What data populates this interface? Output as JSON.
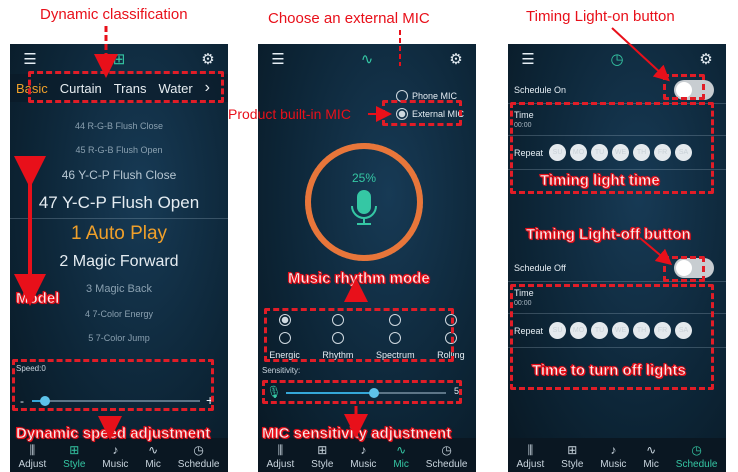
{
  "annotations": {
    "top_left": "Dynamic classification",
    "top_mid": "Choose an external MIC",
    "top_right": "Timing Light-on button",
    "model": "Model",
    "speed": "Dynamic speed adjustment",
    "builtin_mic": "Product built-in MIC",
    "rhythm_mode": "Music rhythm mode",
    "mic_sens": "MIC sensitivity adjustment",
    "timing_light": "Timing light time",
    "light_off_btn": "Timing Light-off button",
    "turn_off": "Time to turn off lights"
  },
  "nav": {
    "items": [
      {
        "label": "Adjust",
        "icon": "sliders-icon"
      },
      {
        "label": "Style",
        "icon": "grid-icon"
      },
      {
        "label": "Music",
        "icon": "music-icon"
      },
      {
        "label": "Mic",
        "icon": "mic-wave-icon"
      },
      {
        "label": "Schedule",
        "icon": "clock-icon"
      }
    ]
  },
  "style_screen": {
    "tabs": [
      "Basic",
      "Curtain",
      "Trans",
      "Water"
    ],
    "more": "›",
    "modes": [
      "44 R-G-B Flush Close",
      "45 R-G-B Flush Open",
      "46 Y-C-P Flush Close",
      "47 Y-C-P Flush Open",
      "1 Auto Play",
      "2 Magic Forward",
      "3 Magic Back",
      "4 7-Color Energy",
      "5 7-Color Jump"
    ],
    "speed_label": "Speed:0",
    "minus": "-",
    "plus": "+",
    "speed_value": 0.08
  },
  "mic_screen": {
    "phone_mic": "Phone MIC",
    "external_mic": "External MIC",
    "percent": "25%",
    "percent_value": 25,
    "modes": [
      "Energic",
      "Rhythm",
      "Spectrum",
      "Rolling"
    ],
    "sensitivity_label": "Sensitivity:",
    "sensitivity_value": "5",
    "sensitivity_fraction": 0.55
  },
  "schedule_screen": {
    "schedule_on": "Schedule On",
    "schedule_off": "Schedule Off",
    "time_label": "Time",
    "time_value": "00:00",
    "repeat_label": "Repeat",
    "days": [
      "SU",
      "MO",
      "TU",
      "WE",
      "TH",
      "FR",
      "SA"
    ]
  },
  "colors": {
    "accent": "#35c7a4",
    "annotation": "#e8101a",
    "tab_active": "#f0a02a",
    "bg": "#0b1f2f"
  }
}
